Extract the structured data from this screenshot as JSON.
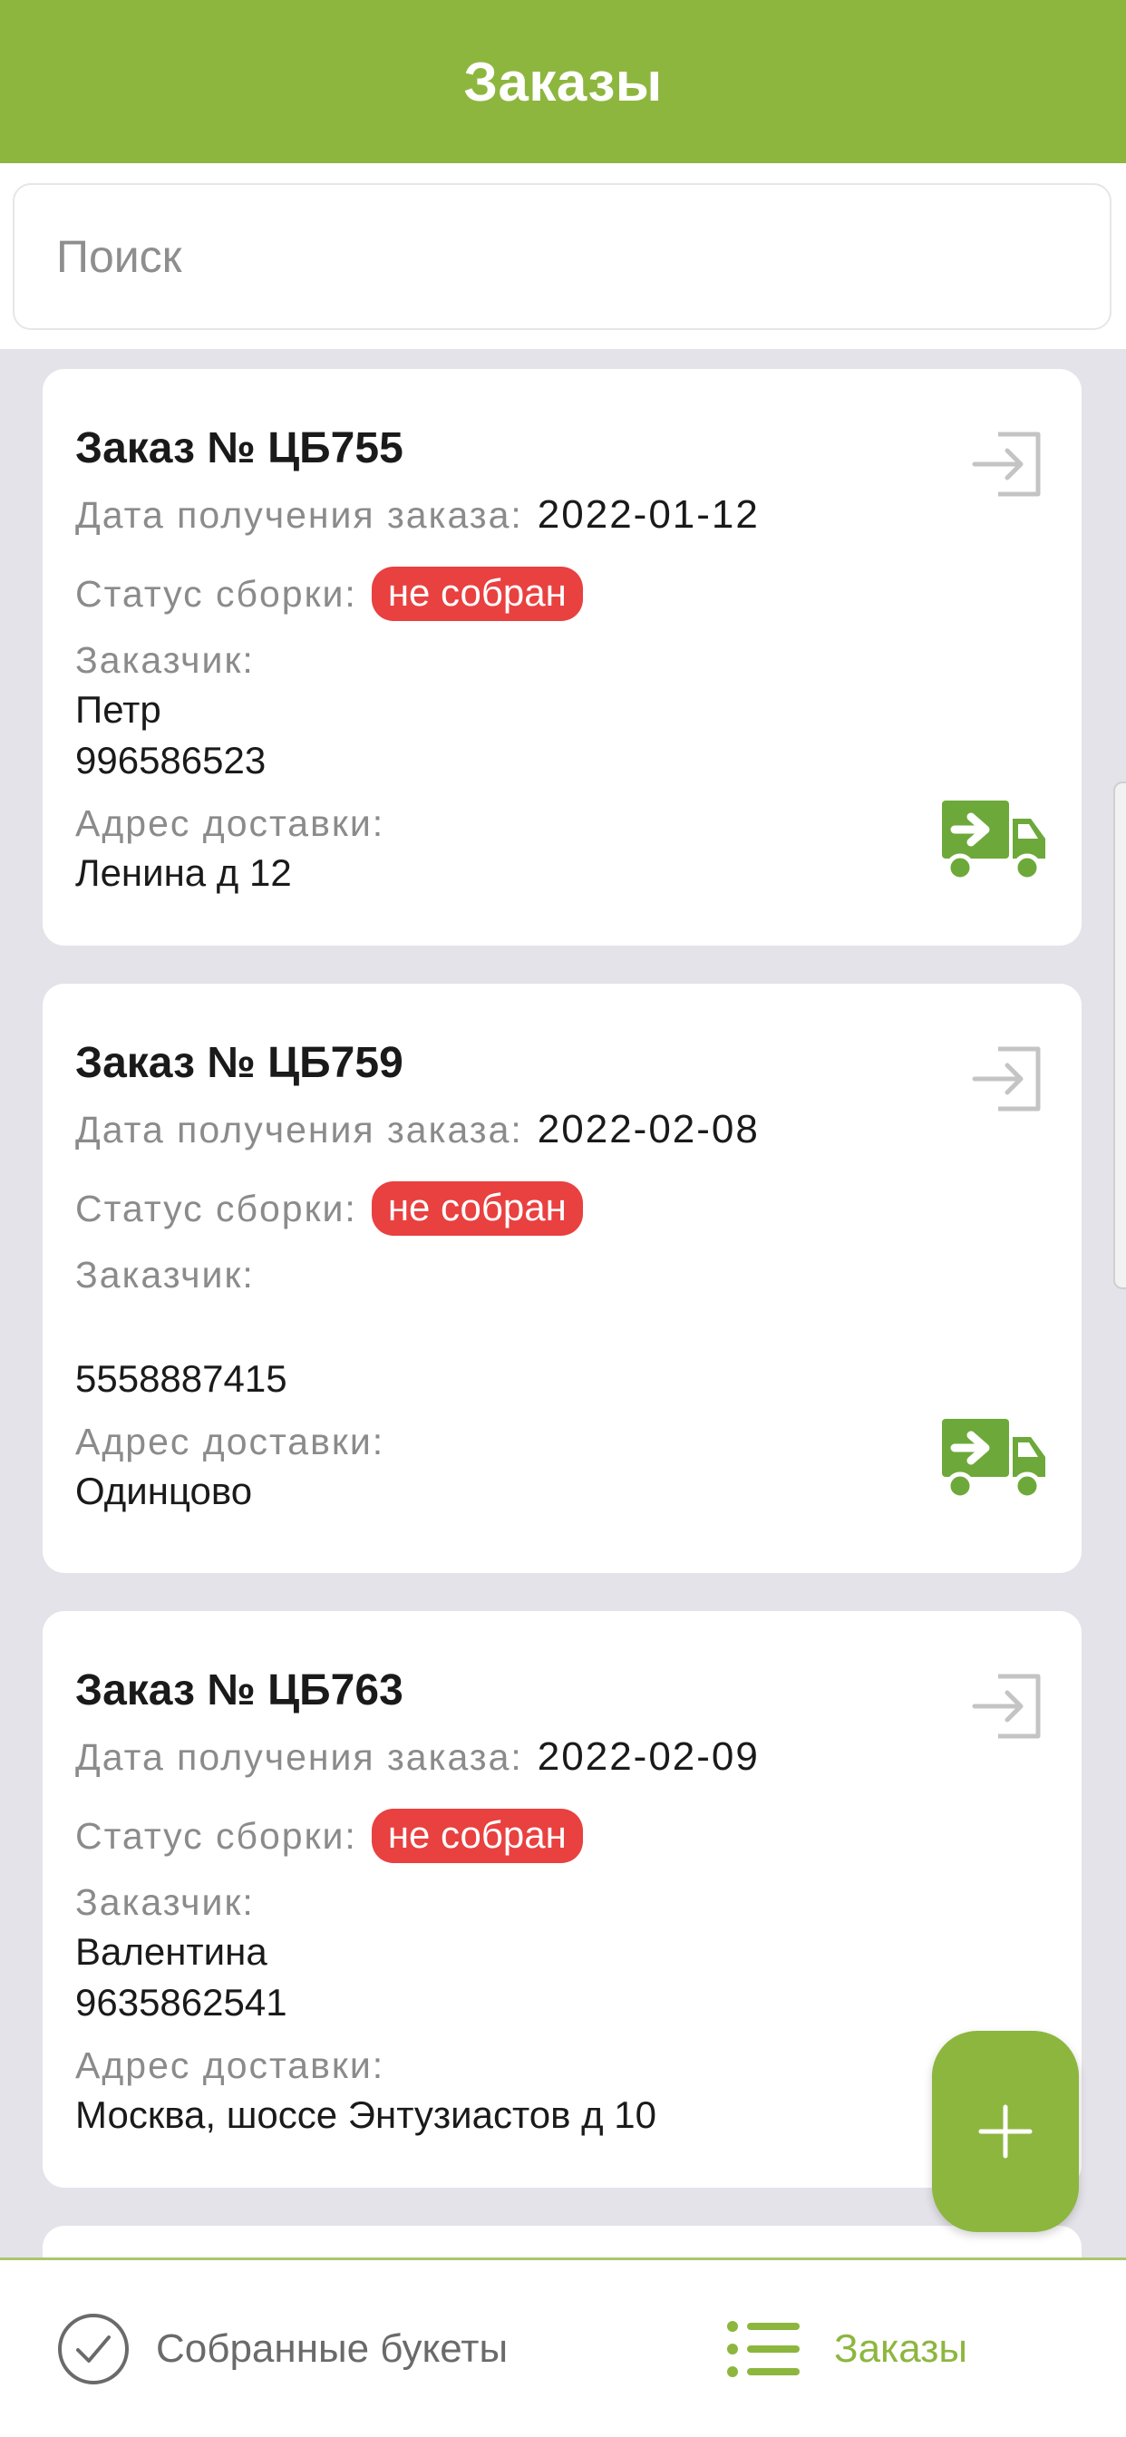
{
  "header": {
    "title": "Заказы"
  },
  "search": {
    "placeholder": "Поиск",
    "value": ""
  },
  "labels": {
    "date": "Дата получения заказа:",
    "status": "Статус сборки:",
    "customer": "Заказчик:",
    "address": "Адрес доставки:"
  },
  "orders": [
    {
      "title": "Заказ № ЦБ755",
      "date": "2022-01-12",
      "status": "не собран",
      "customer_name": "Петр",
      "customer_phone": "996586523",
      "address": "Ленина д 12"
    },
    {
      "title": "Заказ № ЦБ759",
      "date": "2022-02-08",
      "status": "не собран",
      "customer_name": "",
      "customer_phone": "5558887415",
      "address": "Одинцово"
    },
    {
      "title": "Заказ № ЦБ763",
      "date": "2022-02-09",
      "status": "не собран",
      "customer_name": "Валентина",
      "customer_phone": "9635862541",
      "address": "Москва, шоссе Энтузиастов д 10"
    }
  ],
  "icons": {
    "open": "open-order-icon",
    "delivery": "delivery-truck-icon",
    "fab": "plus-icon",
    "nav_collected": "check-circle-icon",
    "nav_orders": "list-icon"
  },
  "colors": {
    "primary": "#8db63f",
    "status_badge": "#e94040",
    "background": "#e4e3e9"
  },
  "bottom_nav": {
    "items": [
      {
        "label": "Собранные букеты",
        "active": false
      },
      {
        "label": "Заказы",
        "active": true
      }
    ]
  }
}
